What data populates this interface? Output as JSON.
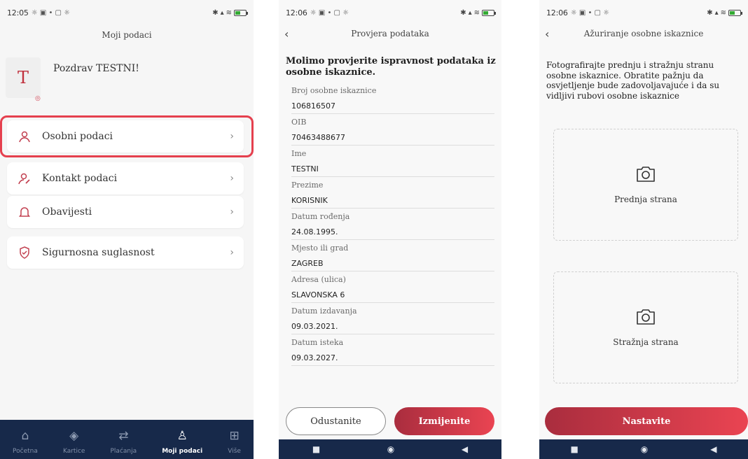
{
  "colors": {
    "accent": "#e5404e",
    "nav_bg": "#17294a",
    "button_gradient": [
      "#a92d3e",
      "#ea4452"
    ]
  },
  "screen1": {
    "status": {
      "time": "12:05",
      "indicators": "☼ ▣ • ▢ ☼"
    },
    "title": "Moji podaci",
    "avatar_letter": "T",
    "greeting": "Pozdrav TESTNI!",
    "menu": [
      {
        "label": "Osobni podaci",
        "icon": "person-icon"
      },
      {
        "label": "Kontakt podaci",
        "icon": "person-edit-icon"
      },
      {
        "label": "Obavijesti",
        "icon": "bell-icon"
      },
      {
        "label": "Sigurnosna suglasnost",
        "icon": "shield-icon"
      }
    ],
    "bottom_nav": [
      {
        "label": "Početna",
        "icon": "home-icon"
      },
      {
        "label": "Kartice",
        "icon": "card-icon"
      },
      {
        "label": "Plaćanja",
        "icon": "transfer-icon"
      },
      {
        "label": "Moji podaci",
        "icon": "user-icon",
        "active": true
      },
      {
        "label": "Više",
        "icon": "grid-icon"
      }
    ]
  },
  "screen2": {
    "status": {
      "time": "12:06",
      "indicators": "☼ ▣ • ▢ ☼"
    },
    "title": "Provjera podataka",
    "heading": "Molimo provjerite ispravnost podataka iz osobne iskaznice.",
    "fields": [
      {
        "label": "Broj osobne iskaznice",
        "value": "106816507"
      },
      {
        "label": "OIB",
        "value": "70463488677"
      },
      {
        "label": "Ime",
        "value": "TESTNI"
      },
      {
        "label": "Prezime",
        "value": "KORISNIK"
      },
      {
        "label": "Datum rođenja",
        "value": "24.08.1995."
      },
      {
        "label": "Mjesto ili grad",
        "value": "ZAGREB"
      },
      {
        "label": "Adresa (ulica)",
        "value": "SLAVONSKA 6"
      },
      {
        "label": "Datum izdavanja",
        "value": "09.03.2021."
      },
      {
        "label": "Datum isteka",
        "value": "09.03.2027."
      }
    ],
    "cancel_label": "Odustanite",
    "edit_label": "Izmijenite"
  },
  "screen3": {
    "status": {
      "time": "12:06",
      "indicators": "☼ ▣ • ▢ ☼"
    },
    "title": "Ažuriranje osobne iskaznice",
    "instructions": "Fotografirajte prednju i stražnju stranu osobne iskaznice. Obratite pažnju da osvjetljenje bude zadovoljavajuće i da su vidljivi rubovi osobne iskaznice",
    "front_label": "Prednja strana",
    "back_label": "Stražnja strana",
    "continue_label": "Nastavite"
  },
  "android_nav": {
    "home": "■",
    "recents": "◉",
    "back": "◀"
  }
}
